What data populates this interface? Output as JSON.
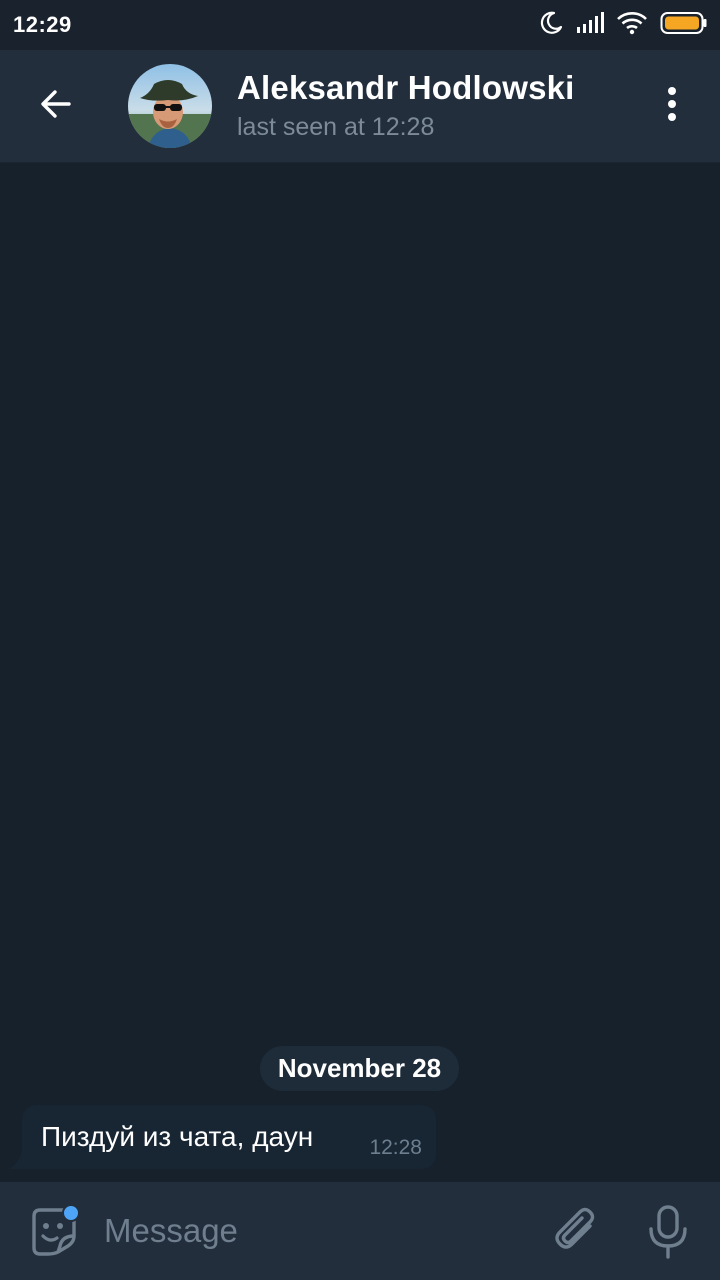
{
  "status_bar": {
    "time": "12:29",
    "icons": [
      "moon-icon",
      "signal-icon",
      "wifi-icon",
      "battery-icon"
    ],
    "battery_color": "#f5a623"
  },
  "header": {
    "back_icon": "arrow-left-icon",
    "contact_name": "Aleksandr Hodlowski",
    "status": "last seen at 12:28",
    "menu_icon": "more-vertical-icon"
  },
  "chat": {
    "date_label": "November 28",
    "messages": [
      {
        "direction": "incoming",
        "text": "Пиздуй из чата, даун",
        "time": "12:28"
      }
    ]
  },
  "input_bar": {
    "emoji_icon": "sticker-emoji-icon",
    "placeholder": "Message",
    "value": "",
    "attach_icon": "paperclip-icon",
    "mic_icon": "microphone-icon"
  },
  "colors": {
    "background": "#17212b",
    "header": "#232e3c",
    "bubble": "#182533",
    "accent": "#4ea4f6",
    "secondary_text": "#7d8b99"
  }
}
